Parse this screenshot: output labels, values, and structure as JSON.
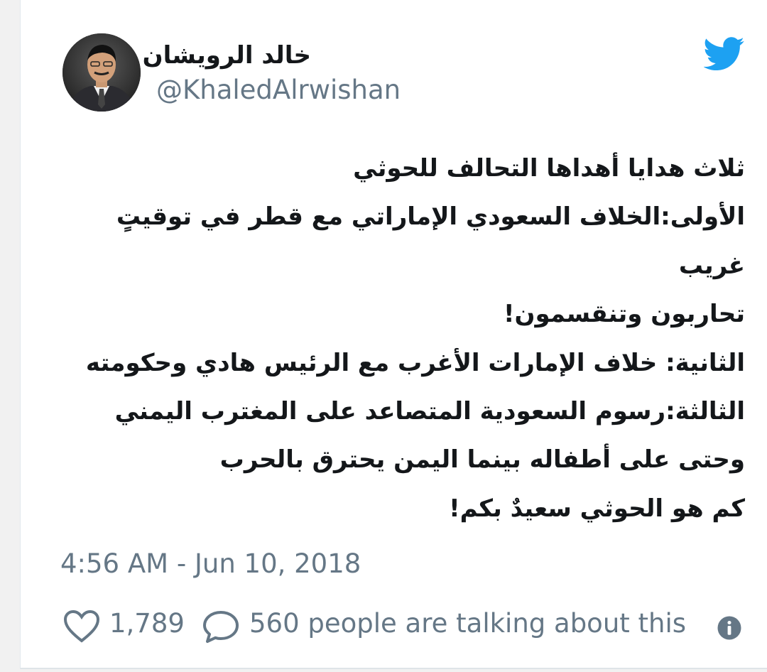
{
  "tweet": {
    "author": {
      "display_name": "خالد الرويشان",
      "handle": "@KhaledAlrwishan",
      "avatar_icon": "avatar-photo"
    },
    "brand_icon": "twitter-bird-icon",
    "brand_color": "#1da1f2",
    "lines": [
      "ثلاث هدايا أهداها التحالف للحوثي",
      "الأولى:الخلاف السعودي الإماراتي مع قطر في توقيتٍ",
      "غريب",
      "تحاربون وتنقسمون!",
      "الثانية: خلاف الإمارات الأغرب مع الرئيس هادي وحكومته",
      "الثالثة:رسوم السعودية المتصاعد على المغترب اليمني",
      "وحتى على أطفاله بينما اليمن يحترق بالحرب",
      "كم هو الحوثي سعيدٌ بكم!"
    ],
    "timestamp": "4:56 AM - Jun 10, 2018",
    "likes": "1,789",
    "talking": "560 people are talking about this",
    "icons": {
      "like": "heart-icon",
      "reply": "speech-bubble-icon",
      "info": "info-icon"
    },
    "colors": {
      "text": "#14171a",
      "secondary": "#657786"
    }
  }
}
